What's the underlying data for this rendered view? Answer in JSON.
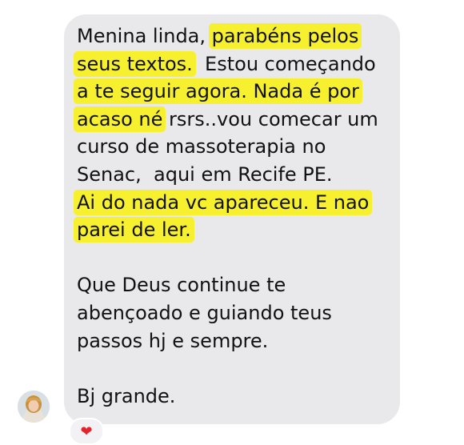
{
  "message": {
    "lines": [
      {
        "plain": "Menina linda, ",
        "highlight": "parabéns pelos"
      },
      {
        "highlight": "seus textos.",
        "plain": "  Estou começando"
      },
      {
        "highlight": "a te seguir agora. Nada é por"
      },
      {
        "highlight": "acaso né",
        "plain": " rsrs..vou comecar um"
      },
      {
        "plain": "curso de massoterapia no"
      },
      {
        "plain": "Senac,  aqui em Recife PE."
      },
      {
        "highlight": "Ai do nada vc apareceu. E nao"
      },
      {
        "highlight": "parei de ler."
      },
      {
        "plain": "Que Deus continue te"
      },
      {
        "plain": "abençoado e guiando teus"
      },
      {
        "plain": "passos hj e sempre."
      },
      {
        "plain": "Bj grande."
      }
    ],
    "highlight_color": "#f7f02e",
    "bubble_color": "#e9e9eb"
  },
  "reaction": {
    "icon": "heart-icon",
    "glyph": "❤",
    "color": "#e3242b"
  },
  "sender": {
    "avatar_icon": "avatar"
  }
}
